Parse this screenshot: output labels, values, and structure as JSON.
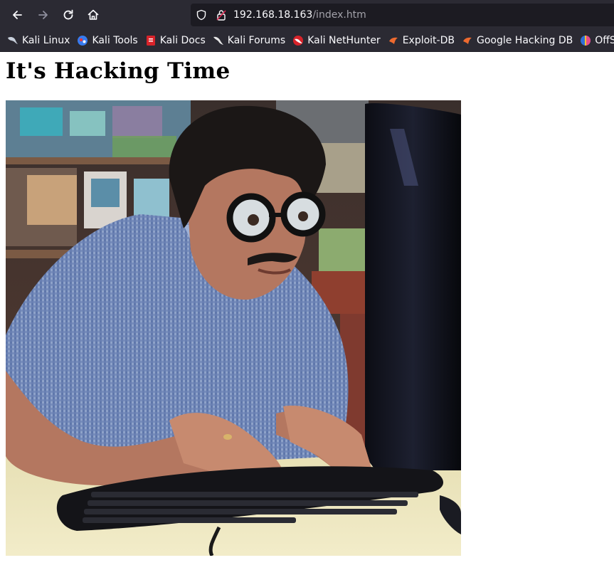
{
  "browser": {
    "url_host": "192.168.18.163",
    "url_path": "/index.htm"
  },
  "bookmarks": [
    {
      "label": "Kali Linux",
      "icon": "kali-dragon-icon"
    },
    {
      "label": "Kali Tools",
      "icon": "kali-tools-icon"
    },
    {
      "label": "Kali Docs",
      "icon": "kali-docs-icon"
    },
    {
      "label": "Kali Forums",
      "icon": "kali-forums-icon"
    },
    {
      "label": "Kali NetHunter",
      "icon": "nethunter-icon"
    },
    {
      "label": "Exploit-DB",
      "icon": "exploit-db-icon"
    },
    {
      "label": "Google Hacking DB",
      "icon": "ghdb-icon"
    },
    {
      "label": "OffSec",
      "icon": "offsec-icon"
    }
  ],
  "page": {
    "heading": "It's Hacking Time",
    "image_alt": ""
  },
  "colors": {
    "chrome_bg": "#2b2a33",
    "urlbar_bg": "#1c1b22",
    "text_light": "#fbfbfe",
    "text_dim": "#a3a2aa",
    "page_bg": "#ffffff"
  }
}
